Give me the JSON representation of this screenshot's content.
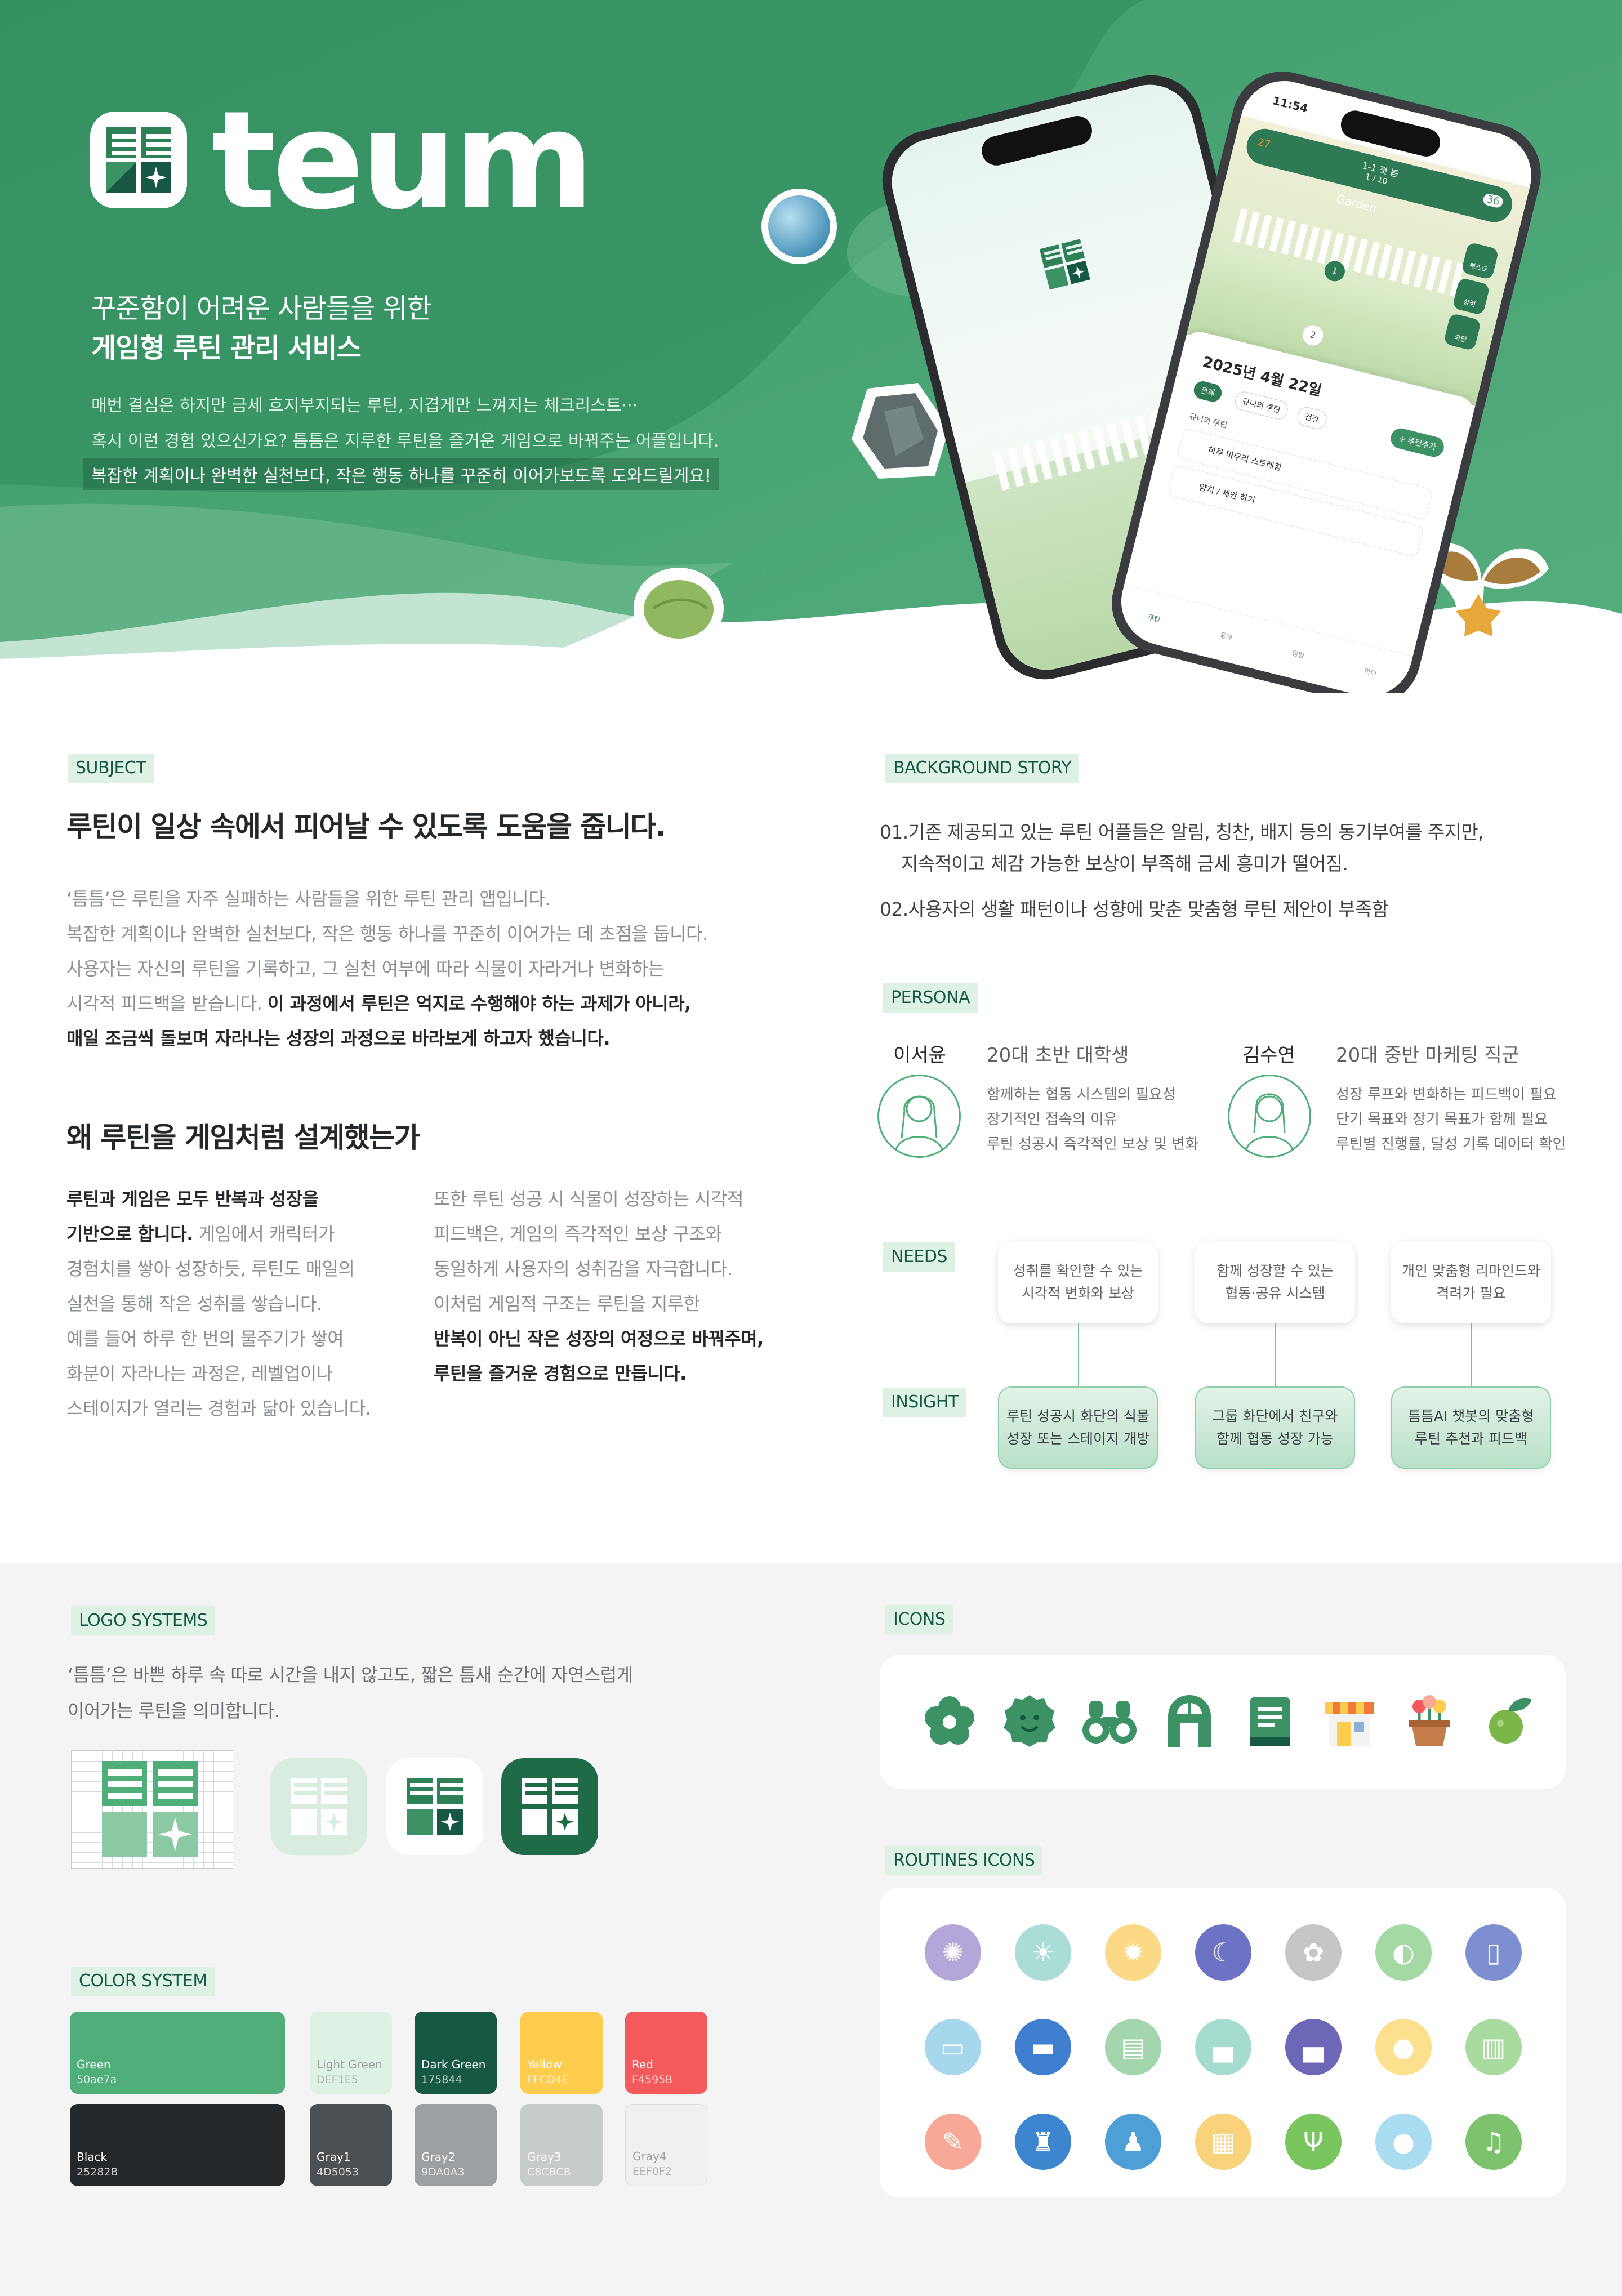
{
  "hero": {
    "brand": "teum",
    "tagline_1": "꾸준함이 어려운 사람들을 위한",
    "tagline_2": "게임형 루틴 관리 서비스",
    "desc_1": "매번 결심은 하지만 금세 흐지부지되는 루틴, 지겹게만 느껴지는 체크리스트···",
    "desc_2": "혹시 이런 경험 있으신가요? 틈틈은 지루한 루틴을 즐거운 게임으로 바꿔주는 어플입니다.",
    "desc_3": "복잡한 계획이나 완벽한 실천보다, 작은 행동 하나를 꾸준히 이어가보도록 도와드릴게요!",
    "phone": {
      "time": "11:54",
      "flame": "27",
      "weather": "맑음",
      "gems": "36",
      "stage": "1-1 첫 봄",
      "progress": "1 / 10",
      "garden": "Garden",
      "date": "2025년 4월 22일",
      "filter": "전체",
      "chip_1": "규니의 루틴",
      "chip_2": "건강",
      "add": "+ 루틴추가",
      "group": "규니의 루틴",
      "routine_1": "하루 마무리 스트레칭",
      "routine_2": "양치 / 세안 하기",
      "side_1": "퀘스트",
      "side_2": "상점",
      "side_3": "화단",
      "nav_1": "루틴",
      "nav_2": "통계",
      "nav_3": "탐험",
      "nav_4": "마이",
      "node_1": "1",
      "node_2": "2"
    }
  },
  "subject": {
    "tag": "SUBJECT",
    "title": "루틴이 일상 속에서 피어날 수 있도록 도움을 줍니다.",
    "l1": "‘틈틈’은 루틴을 자주 실패하는 사람들을 위한 루틴 관리 앱입니다.",
    "l2": "복잡한 계획이나 완벽한 실천보다, 작은 행동 하나를 꾸준히 이어가는 데 초점을 둡니다.",
    "l3": "사용자는 자신의 루틴을 기록하고, 그 실천 여부에 따라 식물이 자라거나 변화하는",
    "l4a": "시각적 피드백을 받습니다. ",
    "l4b": "이 과정에서 루틴은 억지로 수행해야 하는 과제가 아니라,",
    "l5": "매일 조금씩 돌보며 자라나는 성장의 과정으로 바라보게 하고자 했습니다."
  },
  "why": {
    "title": "왜 루틴을 게임처럼 설계했는가",
    "a1": "루틴과 게임은 모두 반복과 성장을",
    "a2b": "기반으로 합니다.",
    "a2": " 게임에서 캐릭터가",
    "a3": "경험치를 쌓아 성장하듯, 루틴도 매일의",
    "a4": "실천을 통해 작은 성취를 쌓습니다.",
    "a5": "예를 들어 하루 한 번의 물주기가 쌓여",
    "a6": "화분이 자라나는 과정은, 레벨업이나",
    "a7": "스테이지가 열리는 경험과 닮아 있습니다.",
    "b1": "또한 루틴 성공 시 식물이 성장하는 시각적",
    "b2": "피드백은, 게임의 즉각적인 보상 구조와",
    "b3": "동일하게 사용자의 성취감을 자극합니다.",
    "b4": "이처럼 게임적 구조는 루틴을 지루한",
    "b5": "반복이 아닌 작은 성장의 여정으로 바꿔주며,",
    "b6": "루틴을 즐거운 경험으로 만듭니다."
  },
  "background": {
    "tag": "BACKGROUND STORY",
    "i1": "01.기존 제공되고 있는 루틴 어플들은 알림, 칭찬, 배지 등의 동기부여를 주지만,",
    "i1b": "지속적이고 체감 가능한 보상이 부족해 금세 흥미가 떨어짐.",
    "i2": "02.사용자의 생활 패턴이나 성향에 맞춘 맞춤형 루틴 제안이 부족함"
  },
  "persona": {
    "tag": "PERSONA",
    "people": [
      {
        "name": "이서윤",
        "role": "20대 초반 대학생",
        "d1": "함께하는 협동 시스템의 필요성",
        "d2": "장기적인 접속의 이유",
        "d3": "루틴 성공시 즉각적인 보상 및 변화"
      },
      {
        "name": "김수연",
        "role": "20대 중반 마케팅 직군",
        "d1": "성장 루프와 변화하는 피드백이 필요",
        "d2": "단기 목표와 장기 목표가 함께 필요",
        "d3": "루틴별 진행률, 달성 기록 데이터 확인"
      }
    ]
  },
  "needs": {
    "tag": "NEEDS",
    "items": [
      {
        "a": "성취를 확인할 수 있는",
        "b": "시각적 변화와 보상"
      },
      {
        "a": "함께 성장할 수 있는",
        "b": "협동·공유 시스템"
      },
      {
        "a": "개인 맞춤형 리마인드와",
        "b": "격려가 필요"
      }
    ]
  },
  "insight": {
    "tag": "INSIGHT",
    "items": [
      {
        "a": "루틴 성공시 화단의 식물",
        "b": "성장 또는 스테이지 개방"
      },
      {
        "a": "그룹 화단에서 친구와",
        "b": "함께 협동 성장 가능"
      },
      {
        "a": "틈틈AI 챗봇의 맞춤형",
        "b": "루틴 추천과 피드백"
      }
    ]
  },
  "logo_systems": {
    "tag": "LOGO SYSTEMS",
    "l1": "‘틈틈’은 바쁜 하루 속 따로 시간을 내지 않고도, 짧은 틈새 순간에 자연스럽게",
    "l2": "이어가는 루틴을 의미합니다."
  },
  "color_system": {
    "tag": "COLOR SYSTEM",
    "colors": [
      {
        "name": "Green",
        "hex": "50ae7a"
      },
      {
        "name": "Light Green",
        "hex": "DEF1E5"
      },
      {
        "name": "Dark Green",
        "hex": "175844"
      },
      {
        "name": "Yellow",
        "hex": "FFCD4E"
      },
      {
        "name": "Red",
        "hex": "F4595B"
      },
      {
        "name": "Black",
        "hex": "25282B"
      },
      {
        "name": "Gray1",
        "hex": "4D5053"
      },
      {
        "name": "Gray2",
        "hex": "9DA0A3"
      },
      {
        "name": "Gray3",
        "hex": "C8CBCB"
      },
      {
        "name": "Gray4",
        "hex": "EEF0F2"
      }
    ]
  },
  "icons": {
    "tag": "ICONS",
    "names": [
      "flower-icon",
      "smile-badge-icon",
      "binoculars-icon",
      "greenhouse-icon",
      "book-icon",
      "shop-icon",
      "flower-pot-icon",
      "leaf-fruit-icon"
    ]
  },
  "routine_icons": {
    "tag": "ROUTINES ICONS",
    "items": [
      {
        "icon": "sun-gear-icon",
        "bg": "#b4a6d9"
      },
      {
        "icon": "sun-icon",
        "bg": "#a9ddd6"
      },
      {
        "icon": "sun-orange-icon",
        "bg": "#fbd987"
      },
      {
        "icon": "moon-icon",
        "bg": "#6c72c4"
      },
      {
        "icon": "flower-white-icon",
        "bg": "#c4c6c8"
      },
      {
        "icon": "pill-icon",
        "bg": "#a5d9a3"
      },
      {
        "icon": "phone-icon",
        "bg": "#7d8fd0"
      },
      {
        "icon": "water-glass-icon",
        "bg": "#a7d7ec"
      },
      {
        "icon": "dumbbell-icon",
        "bg": "#3f7fd0"
      },
      {
        "icon": "open-book-icon",
        "bg": "#a4d6ae"
      },
      {
        "icon": "bed-icon",
        "bg": "#a6dcd0"
      },
      {
        "icon": "bed-purple-icon",
        "bg": "#6d67b8"
      },
      {
        "icon": "egg-icon",
        "bg": "#fde08d"
      },
      {
        "icon": "trash-icon",
        "bg": "#a9db9f"
      },
      {
        "icon": "memo-icon",
        "bg": "#f7a897"
      },
      {
        "icon": "broom-icon",
        "bg": "#3d86cf"
      },
      {
        "icon": "stretch-icon",
        "bg": "#4e9fd6"
      },
      {
        "icon": "reading-icon",
        "bg": "#f8d37b"
      },
      {
        "icon": "meal-icon",
        "bg": "#79c55e"
      },
      {
        "icon": "droplet-icon",
        "bg": "#a9dcf0"
      },
      {
        "icon": "music-icon",
        "bg": "#7dc26c"
      }
    ]
  }
}
